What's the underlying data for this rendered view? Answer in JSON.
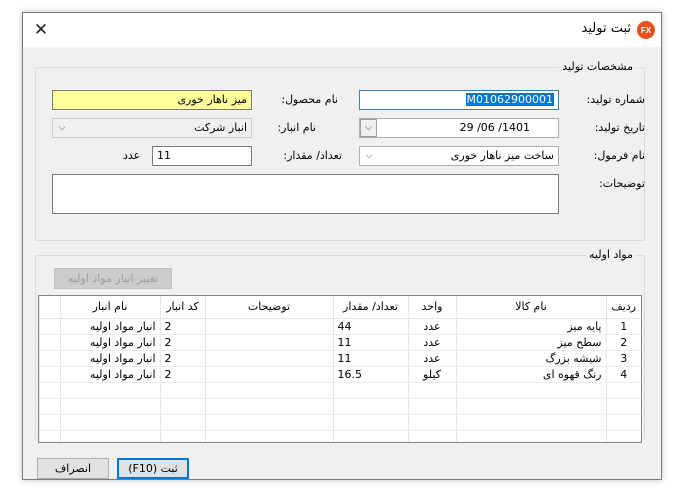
{
  "window": {
    "title": "ثبت تولید",
    "logo_text": "FX",
    "close_glyph": "✕"
  },
  "production": {
    "group_title": "مشخصات تولید",
    "production_number_label": "شماره تولید:",
    "production_number_value": "M01062900001",
    "product_name_label": "نام محصول:",
    "product_name_value": "میز ناهار خوری",
    "production_date_label": "تاریخ تولید:",
    "production_date_value": "1401/ 06/ 29",
    "warehouse_label": "نام انبار:",
    "warehouse_value": "انبار شرکت",
    "formula_label": "نام فرمول:",
    "formula_value": "ساخت میز ناهار خوری",
    "quantity_label": "تعداد/ مقدار:",
    "quantity_value": "11",
    "quantity_unit": "عدد",
    "description_label": "توضیحات:",
    "description_value": ""
  },
  "materials": {
    "group_title": "مواد اولیه",
    "change_warehouse_button": "تغییر انبار مواد اولیه",
    "columns": [
      "ردیف",
      "نام کالا",
      "واحد",
      "تعداد/ مقدار",
      "توضیحات",
      "کد انبار",
      "نام انبار"
    ],
    "rows": [
      [
        "1",
        "پایه میز",
        "عدد",
        "44",
        "",
        "2",
        "انبار مواد اولیه"
      ],
      [
        "2",
        "سطح میز",
        "عدد",
        "11",
        "",
        "2",
        "انبار مواد اولیه"
      ],
      [
        "3",
        "شیشه بزرگ",
        "عدد",
        "11",
        "",
        "2",
        "انبار مواد اولیه"
      ],
      [
        "4",
        "رنگ قهوه ای",
        "کیلو",
        "16.5",
        "",
        "2",
        "انبار مواد اولیه"
      ]
    ]
  },
  "footer": {
    "save_button": "ثبت (F10)",
    "cancel_button": "انصراف"
  }
}
